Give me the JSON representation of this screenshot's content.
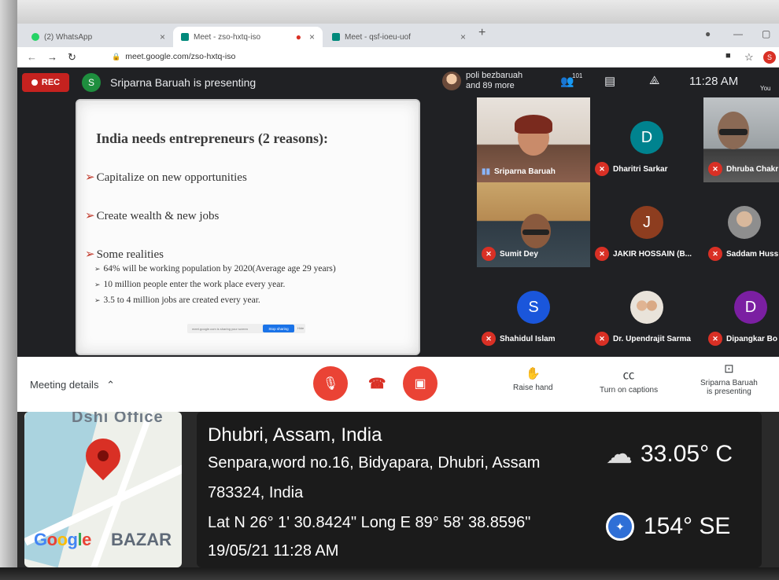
{
  "browser": {
    "tabs": [
      {
        "label": "(2) WhatsApp",
        "color": "#25d366",
        "active": false
      },
      {
        "label": "Meet - zso-hxtq-iso",
        "color": "#00897b",
        "active": true
      },
      {
        "label": "Meet - qsf-ioeu-uof",
        "color": "#00897b",
        "active": false
      }
    ],
    "new_tab": "+",
    "url": "meet.google.com/zso-hxtq-iso",
    "profile_initial": "S"
  },
  "meet": {
    "rec_label": "REC",
    "presenter_initial": "S",
    "presenting_text": "Sriparna Baruah is presenting",
    "top_participant_line1": "poli bezbaruah",
    "top_participant_line2": "and 89 more",
    "people_count": "101",
    "time": "11:28 AM",
    "you_label": "You"
  },
  "slide": {
    "title": "India needs entrepreneurs (2 reasons):",
    "bullets": [
      "Capitalize on new opportunities",
      "Create wealth & new jobs",
      "Some realities"
    ],
    "sub_bullets": [
      "64% will be working population by 2020(Average age 29 years)",
      "10 million people enter the work place every year.",
      "3.5 to 4 million jobs are created every year."
    ],
    "share_text": "meet.google.com is sharing your screen",
    "stop_label": "Stop sharing",
    "hide_label": "Hide"
  },
  "participants": [
    {
      "name": "Sriparna Baruah",
      "type": "video",
      "muted": false
    },
    {
      "name": "Dharitri Sarkar",
      "type": "initial",
      "initial": "D",
      "color": "#00838f",
      "muted": true
    },
    {
      "name": "Dhruba Chakr",
      "type": "video",
      "muted": true
    },
    {
      "name": "Sumit Dey",
      "type": "video",
      "muted": true
    },
    {
      "name": "JAKIR HOSSAIN (B...",
      "type": "initial",
      "initial": "J",
      "color": "#8d3d1f",
      "muted": true
    },
    {
      "name": "Saddam Huss",
      "type": "photo",
      "muted": true
    },
    {
      "name": "Shahidul Islam",
      "type": "initial",
      "initial": "S",
      "color": "#1a56db",
      "muted": true
    },
    {
      "name": "Dr. Upendrajit Sarma",
      "type": "photo",
      "muted": true
    },
    {
      "name": "Dipangkar Bo",
      "type": "initial",
      "initial": "D",
      "color": "#7b1fa2",
      "muted": true
    }
  ],
  "controls": {
    "details_label": "Meeting details",
    "raise_hand": "Raise hand",
    "captions": "Turn on captions",
    "presenting_line1": "Sriparna Baruah",
    "presenting_line2": "is presenting"
  },
  "gps": {
    "map_label_top": "Dshi Office",
    "map_logo": "Google",
    "map_label_bottom": "BAZAR",
    "place": "Dhubri, Assam, India",
    "address1": "Senpara,word no.16, Bidyapara, Dhubri, Assam",
    "address2": "783324, India",
    "coords": "Lat N 26° 1' 30.8424\" Long E 89° 58' 38.8596\"",
    "datetime": "19/05/21 11:28 AM",
    "temperature": "33.05° C",
    "heading": "154° SE"
  }
}
